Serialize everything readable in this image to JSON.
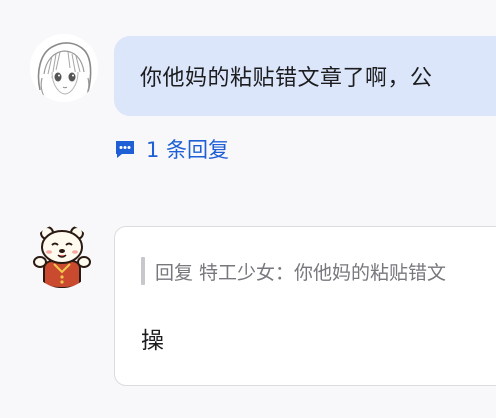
{
  "thread": {
    "first_message": {
      "text": "你他妈的粘贴错文章了啊，公",
      "avatar_icon": "anime-girl-avatar-icon"
    },
    "reply_count_link": {
      "label": "1 条回复",
      "icon": "comment-bubble-icon",
      "color": "#1f5fd6"
    },
    "reply": {
      "avatar_icon": "bear-avatar-icon",
      "quote_text": "回复 特工少女：你他妈的粘贴错文",
      "body_text": "操"
    }
  },
  "colors": {
    "bubble_mine": "#dbe6fb",
    "link_blue": "#1f5fd6",
    "quote_gray": "#77777d"
  }
}
